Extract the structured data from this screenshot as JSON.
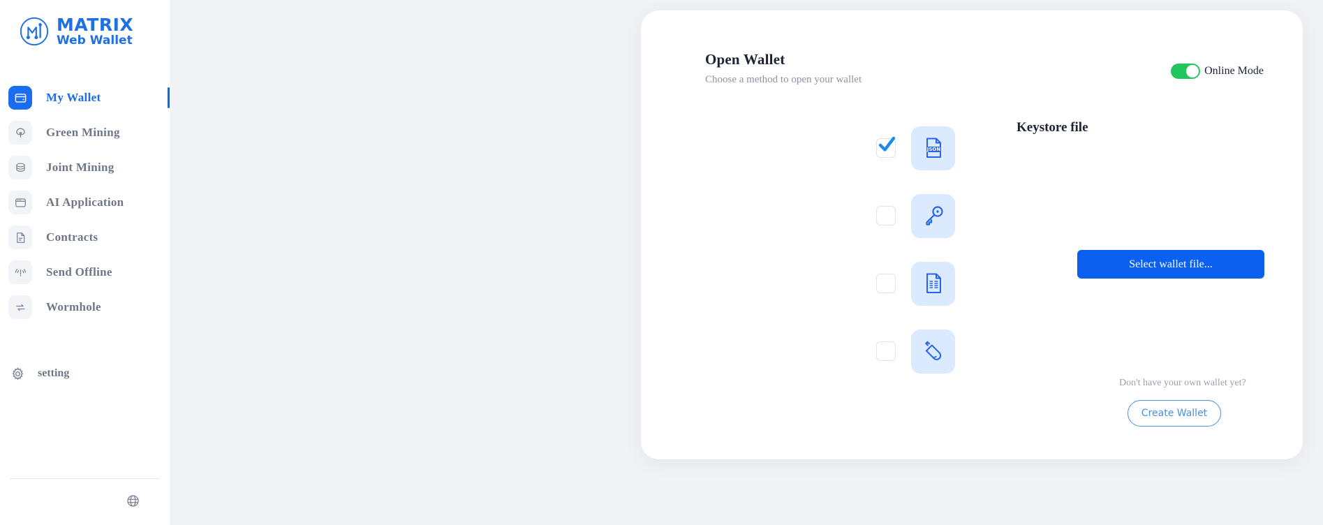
{
  "brand": {
    "title": "MATRIX",
    "subtitle": "Web Wallet",
    "logo_icon": "matrix-logo-icon"
  },
  "sidebar": {
    "items": [
      {
        "label": "My Wallet",
        "icon": "wallet-icon",
        "active": true
      },
      {
        "label": "Green Mining",
        "icon": "tree-icon",
        "active": false
      },
      {
        "label": "Joint Mining",
        "icon": "coins-stack-icon",
        "active": false
      },
      {
        "label": "AI Application",
        "icon": "app-window-icon",
        "active": false
      },
      {
        "label": "Contracts",
        "icon": "document-icon",
        "active": false
      },
      {
        "label": "Send Offline",
        "icon": "signal-off-icon",
        "active": false
      },
      {
        "label": "Wormhole",
        "icon": "swap-arrows-icon",
        "active": false
      }
    ],
    "setting": {
      "label": "setting",
      "icon": "gear-icon"
    },
    "language": {
      "icon": "globe-icon"
    }
  },
  "card": {
    "title": "Open Wallet",
    "subtitle": "Choose a method to open your wallet",
    "mode_toggle": {
      "label": "Online Mode",
      "on": true,
      "on_color": "#22c55e"
    },
    "methods": [
      {
        "icon": "json-file-icon",
        "selected": true,
        "badge": "JSON"
      },
      {
        "icon": "key-icon",
        "selected": false,
        "badge": ""
      },
      {
        "icon": "text-document-icon",
        "selected": false,
        "badge": ""
      },
      {
        "icon": "usb-drive-icon",
        "selected": false,
        "badge": ""
      }
    ],
    "pane": {
      "title": "Keystore file",
      "select_file_label": "Select wallet file...",
      "create_hint": "Don't have your own wallet yet?",
      "create_wallet_label": "Create Wallet"
    }
  },
  "colors": {
    "accent": "#1a6cf0",
    "button_blue": "#0b60f0",
    "icon_tile_bg": "#dbeafe",
    "page_bg": "#f1f2f6",
    "toggle_green": "#22c55e"
  }
}
